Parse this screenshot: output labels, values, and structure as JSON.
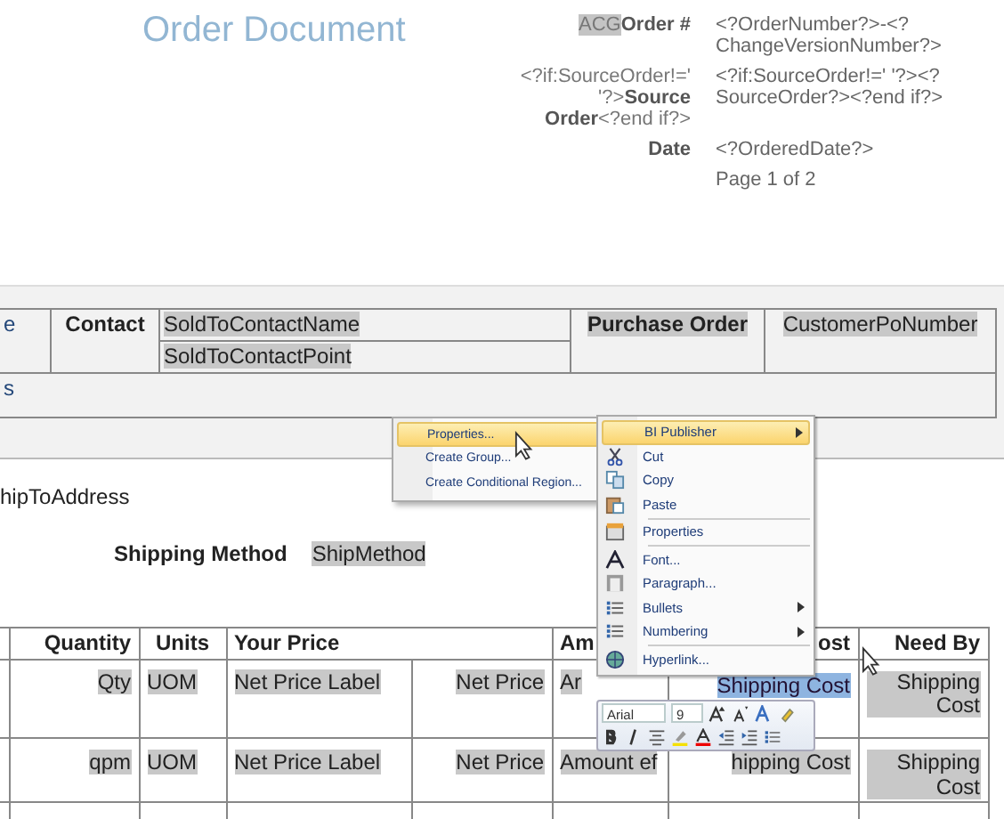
{
  "title": "Order Document",
  "header_fields": [
    {
      "prefix": "ACG",
      "prefix_highlighted": true,
      "label": "Order #",
      "value": "<?OrderNumber?>-<?ChangeVersionNumber?>"
    },
    {
      "prefix": "<?if:SourceOrder!=' '?>",
      "prefix_highlighted": false,
      "label": "Source Order",
      "suffix": "<?end if?>",
      "value": "<?if:SourceOrder!=' '?><?SourceOrder?><?end if?>"
    },
    {
      "label": "Date",
      "value": "<?OrderedDate?>"
    },
    {
      "value": "Page 1 of 2"
    }
  ],
  "contact": {
    "cut_top": "e",
    "label": "Contact",
    "names": [
      "SoldToContactName",
      "SoldToContactPoint"
    ],
    "po_label": "Purchase Order",
    "po_value": "CustomerPoNumber",
    "cut_bottom": "s"
  },
  "shipping": {
    "address": "hipToAddress",
    "method_label": "Shipping Method",
    "method_value": "ShipMethod"
  },
  "lines": {
    "columns": [
      "Quantity",
      "Units",
      "Your Price",
      "Am",
      "ost",
      "Need By"
    ],
    "rows": [
      {
        "quantity": "Qty",
        "units": "UOM",
        "price_label": "Net Price Label",
        "price": "Net Price",
        "amount": "Ar",
        "shipping": "Shipping Cost",
        "selected": true,
        "need_by": "Shipping Cost"
      },
      {
        "quantity": "qpm",
        "units": "UOM",
        "price_label": "Net Price Label",
        "price": "Net Price",
        "amount": "Amount ef",
        "shipping": "hipping Cost",
        "selected": false,
        "need_by": "Shipping Cost"
      }
    ]
  },
  "submenu": [
    {
      "label": "Properties...",
      "selected": true
    },
    {
      "label": "Create Group...",
      "selected": false
    },
    {
      "label": "Create Conditional Region...",
      "selected": false
    }
  ],
  "context_menu": [
    {
      "kind": "item",
      "label": "BI Publisher",
      "selected": true,
      "submenu": true
    },
    {
      "kind": "item",
      "label": "Cut",
      "selected": false
    },
    {
      "kind": "item",
      "label": "Copy",
      "selected": false
    },
    {
      "kind": "item",
      "label": "Paste",
      "selected": false
    },
    {
      "kind": "separator"
    },
    {
      "kind": "item",
      "label": "Properties",
      "selected": false
    },
    {
      "kind": "separator"
    },
    {
      "kind": "item",
      "label": "Font...",
      "selected": false
    },
    {
      "kind": "item",
      "label": "Paragraph...",
      "selected": false
    },
    {
      "kind": "item",
      "label": "Bullets",
      "selected": false,
      "submenu": true
    },
    {
      "kind": "item",
      "label": "Numbering",
      "selected": false,
      "submenu": true
    },
    {
      "kind": "separator"
    },
    {
      "kind": "item",
      "label": "Hyperlink...",
      "selected": false
    }
  ],
  "mini_toolbar": {
    "font": "Arial",
    "size": "9"
  }
}
